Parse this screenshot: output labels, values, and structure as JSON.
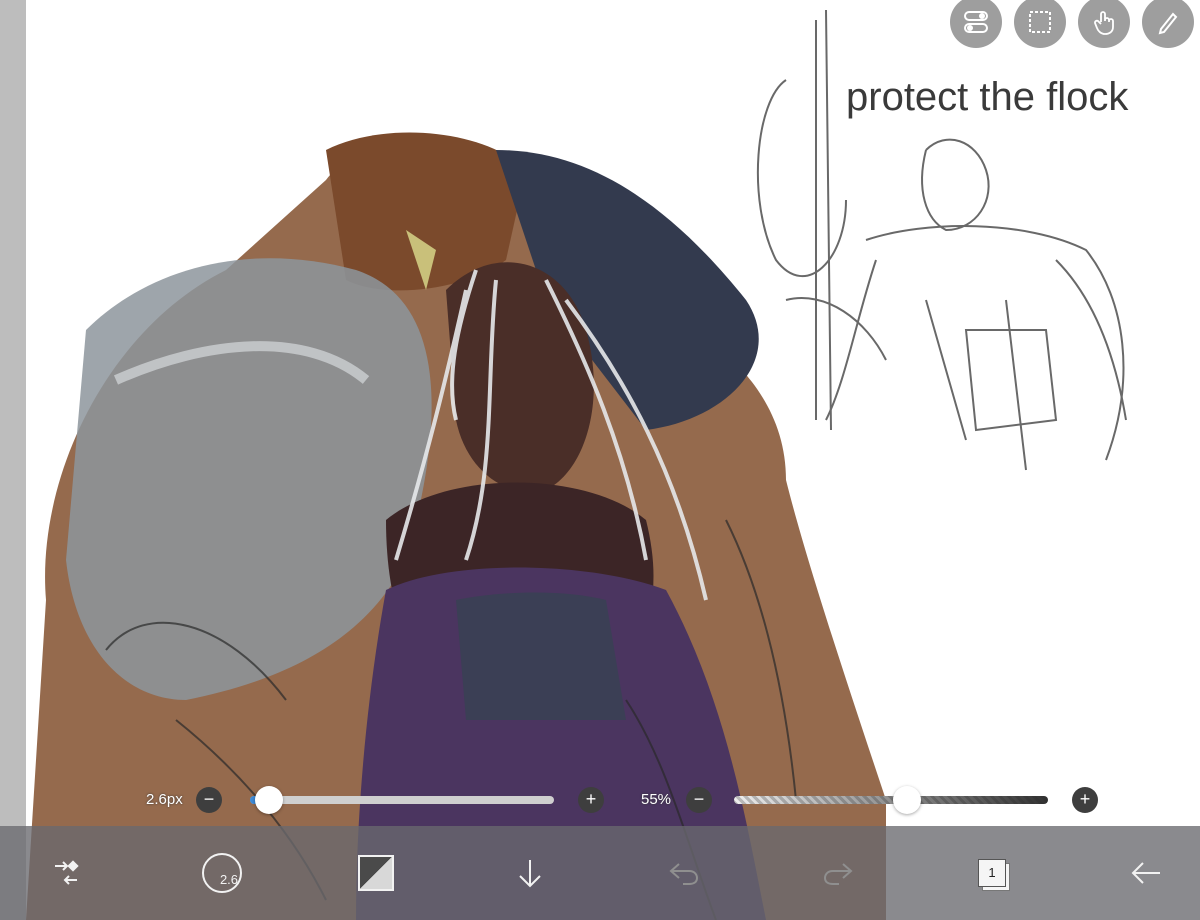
{
  "canvas": {
    "sketch_caption": "protect the flock"
  },
  "top_toolbar": {
    "items": [
      {
        "icon": "toggle-switch-icon"
      },
      {
        "icon": "selection-marquee-icon"
      },
      {
        "icon": "hand-touch-icon"
      },
      {
        "icon": "pen-settings-icon"
      }
    ]
  },
  "brush_size_slider": {
    "label": "2.6px",
    "minus": "−",
    "plus": "+",
    "value_fraction": 0.03,
    "fill_color": "#3e8ad6"
  },
  "opacity_slider": {
    "label": "55%",
    "minus": "−",
    "plus": "+",
    "value_fraction": 0.55
  },
  "bottom_toolbar": {
    "tool_switch_icon": "tool-switch-icon",
    "brush_size_value": "2.6",
    "color_swatch_icon": "color-swatch-icon",
    "download_icon": "arrow-down-icon",
    "undo_icon": "undo-icon",
    "redo_icon": "redo-icon",
    "layer_count": "1",
    "back_icon": "arrow-left-icon"
  }
}
